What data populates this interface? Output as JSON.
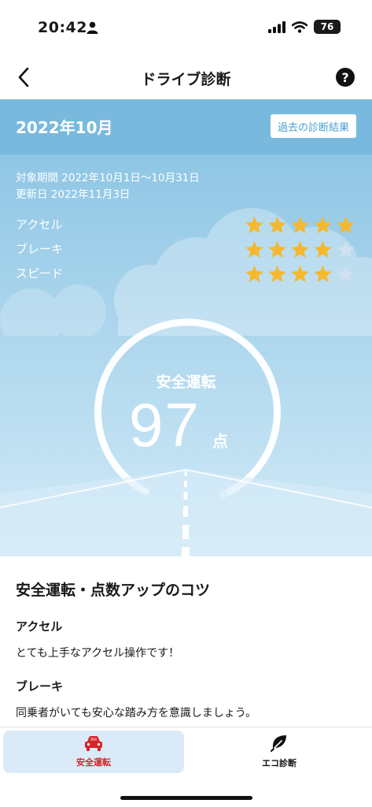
{
  "status_bar": {
    "time": "20:42",
    "battery": "76"
  },
  "nav": {
    "title": "ドライブ診断"
  },
  "hero": {
    "month": "2022年10月",
    "history_button": "過去の診断結果",
    "period": "対象期間 2022年10月1日〜10月31日",
    "updated": "更新日 2022年11月3日",
    "scores": [
      {
        "label": "アクセル",
        "stars": 5,
        "max": 5
      },
      {
        "label": "ブレーキ",
        "stars": 4,
        "max": 5
      },
      {
        "label": "スピード",
        "stars": 4,
        "max": 5
      }
    ],
    "gauge_caption": "安全運転",
    "score": "97",
    "score_unit": "点"
  },
  "tips": {
    "title": "安全運転・点数アップのコツ",
    "items": [
      {
        "heading": "アクセル",
        "text": "とても上手なアクセル操作です！"
      },
      {
        "heading": "ブレーキ",
        "text": "同乗者がいても安心な踏み方を意識しましょう。"
      }
    ]
  },
  "tab_bar": {
    "tabs": [
      {
        "label": "安全運転",
        "icon": "car-icon",
        "active": true
      },
      {
        "label": "エコ診断",
        "icon": "leaf-icon",
        "active": false
      }
    ]
  },
  "colors": {
    "accent_red": "#d9222a",
    "star_filled": "#f5b82e",
    "star_empty": "#cfe1ee",
    "sky_top": "#7ab9de"
  }
}
